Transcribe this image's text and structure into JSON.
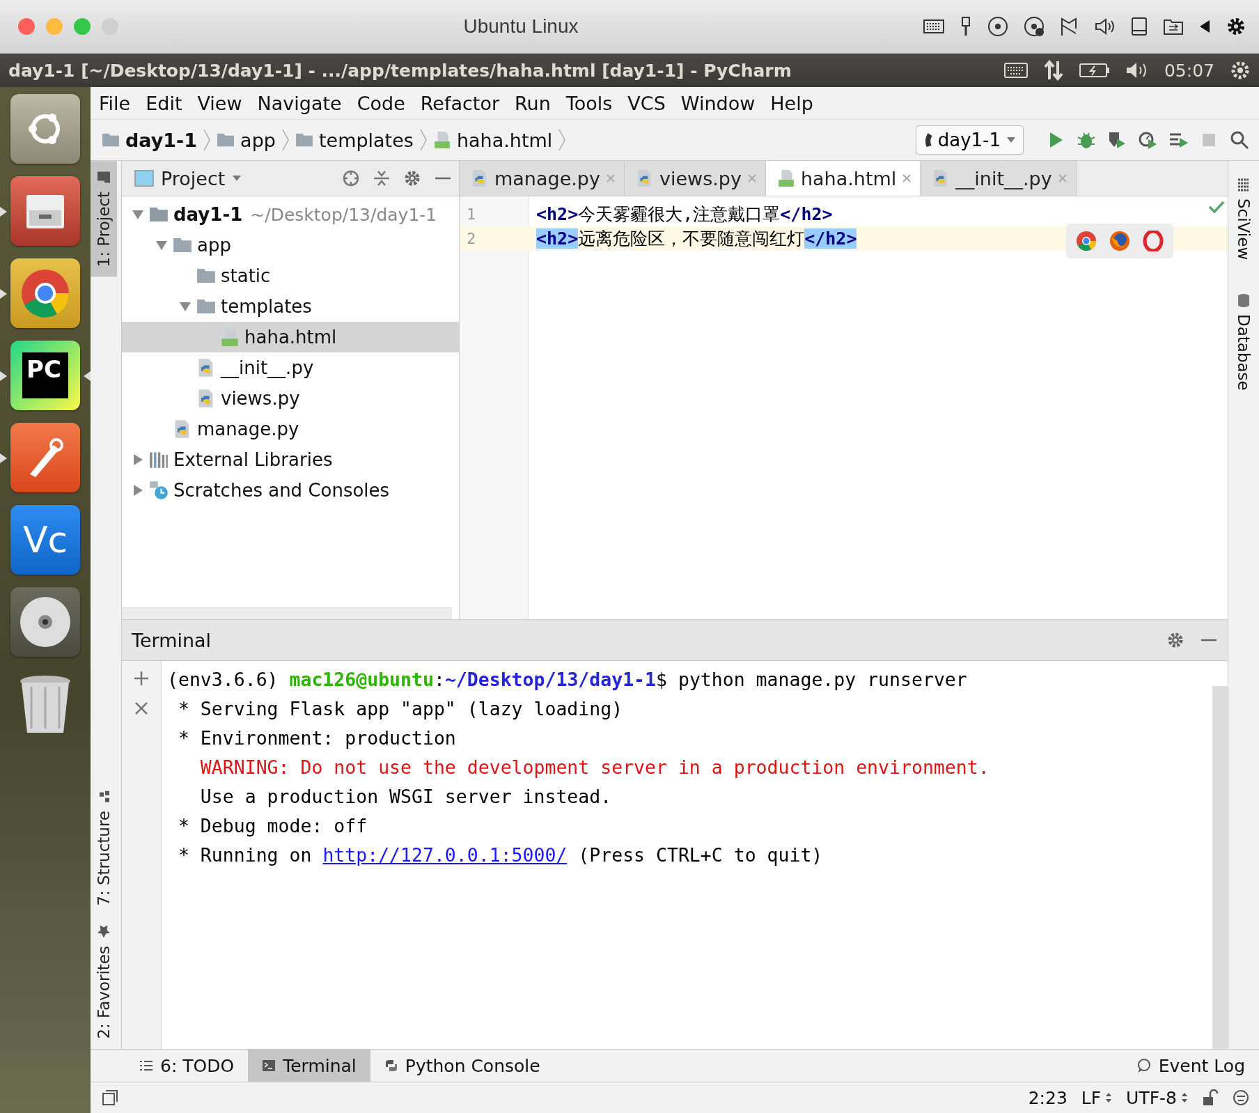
{
  "mac_window": {
    "title": "Ubuntu Linux"
  },
  "ubuntu_panel": {
    "title": "day1-1 [~/Desktop/13/day1-1] - .../app/templates/haha.html [day1-1] - PyCharm",
    "clock": "05:07"
  },
  "launcher": [
    {
      "kind": "ubuntu",
      "running": false,
      "focused": false
    },
    {
      "kind": "files",
      "running": true,
      "focused": false
    },
    {
      "kind": "chrome",
      "running": true,
      "focused": false
    },
    {
      "kind": "pycharm",
      "label": "PC",
      "running": true,
      "focused": true
    },
    {
      "kind": "postman",
      "running": true,
      "focused": false
    },
    {
      "kind": "vnc",
      "label": "Vc",
      "running": false,
      "focused": false
    },
    {
      "kind": "disc",
      "running": false,
      "focused": false
    },
    {
      "kind": "trash",
      "running": false,
      "focused": false
    }
  ],
  "menu": [
    "File",
    "Edit",
    "View",
    "Navigate",
    "Code",
    "Refactor",
    "Run",
    "Tools",
    "VCS",
    "Window",
    "Help"
  ],
  "breadcrumbs": [
    {
      "label": "day1-1",
      "kind": "project"
    },
    {
      "label": "app",
      "kind": "folder"
    },
    {
      "label": "templates",
      "kind": "folder"
    },
    {
      "label": "haha.html",
      "kind": "html"
    }
  ],
  "run_config": {
    "label": "day1-1"
  },
  "toolbar": [
    {
      "kind": "run",
      "disabled": false
    },
    {
      "kind": "debug",
      "disabled": false
    },
    {
      "kind": "coverage",
      "disabled": false
    },
    {
      "kind": "profile",
      "disabled": false
    },
    {
      "kind": "concurrency",
      "disabled": false
    },
    {
      "kind": "stop",
      "disabled": true
    },
    {
      "kind": "search",
      "disabled": false
    }
  ],
  "left_tool_tabs": {
    "top": [
      {
        "label": "1: Project",
        "selected": true,
        "kind": "project"
      }
    ],
    "bottom": [
      {
        "label": "7: Structure",
        "selected": false,
        "kind": "structure"
      },
      {
        "label": "2: Favorites",
        "selected": false,
        "kind": "favorites"
      }
    ]
  },
  "right_tool_tabs": [
    {
      "label": "SciView",
      "kind": "sciview"
    },
    {
      "label": "Database",
      "kind": "database"
    }
  ],
  "project_panel": {
    "title": "Project",
    "tree": [
      {
        "label": "day1-1",
        "path": "~/Desktop/13/day1-1",
        "kind": "project",
        "expanded": true,
        "selected": false,
        "children": [
          {
            "label": "app",
            "kind": "folder",
            "expanded": true,
            "selected": false,
            "children": [
              {
                "label": "static",
                "kind": "folder",
                "selected": false
              },
              {
                "label": "templates",
                "kind": "folder",
                "expanded": true,
                "selected": false,
                "children": [
                  {
                    "label": "haha.html",
                    "kind": "html",
                    "selected": true
                  }
                ]
              },
              {
                "label": "__init__.py",
                "kind": "python",
                "selected": false
              },
              {
                "label": "views.py",
                "kind": "python",
                "selected": false
              }
            ]
          },
          {
            "label": "manage.py",
            "kind": "python",
            "selected": false
          }
        ]
      },
      {
        "label": "External Libraries",
        "kind": "libraries",
        "expanded": false,
        "selected": false
      },
      {
        "label": "Scratches and Consoles",
        "kind": "scratches",
        "expanded": false,
        "selected": false
      }
    ]
  },
  "editor_tabs": [
    {
      "label": "manage.py",
      "kind": "python",
      "selected": false
    },
    {
      "label": "views.py",
      "kind": "python",
      "selected": false
    },
    {
      "label": "haha.html",
      "kind": "html",
      "selected": true
    },
    {
      "label": "__init__.py",
      "kind": "python",
      "selected": false
    }
  ],
  "editor": {
    "lines": [
      {
        "number": "1",
        "current": false,
        "segments": [
          {
            "text": "<h2>",
            "kind": "tag",
            "matched": false
          },
          {
            "text": "今天雾霾很大,注意戴口罩",
            "kind": "text"
          },
          {
            "text": "</h2>",
            "kind": "tag",
            "matched": false
          }
        ]
      },
      {
        "number": "2",
        "current": true,
        "segments": [
          {
            "text": "<h2>",
            "kind": "tag",
            "matched": true
          },
          {
            "text": "远离危险区，不要随意闯红灯",
            "kind": "text"
          },
          {
            "text": "</h2>",
            "kind": "tag",
            "matched": true
          }
        ]
      }
    ]
  },
  "terminal": {
    "title": "Terminal",
    "lines": [
      [
        {
          "text": "(env3.6.6) ",
          "kind": "plain"
        },
        {
          "text": "mac126@ubuntu",
          "kind": "user"
        },
        {
          "text": ":",
          "kind": "plain"
        },
        {
          "text": "~/Desktop/13/day1-1",
          "kind": "path"
        },
        {
          "text": "$ python manage.py runserver",
          "kind": "plain"
        }
      ],
      [
        {
          "text": " * Serving Flask app \"app\" (lazy loading)",
          "kind": "plain"
        }
      ],
      [
        {
          "text": " * Environment: production",
          "kind": "plain"
        }
      ],
      [
        {
          "text": "   WARNING: Do not use the development server in a production environment.",
          "kind": "warning"
        }
      ],
      [
        {
          "text": "   Use a production WSGI server instead.",
          "kind": "plain"
        }
      ],
      [
        {
          "text": " * Debug mode: off",
          "kind": "plain"
        }
      ],
      [
        {
          "text": " * Running on ",
          "kind": "plain"
        },
        {
          "text": "http://127.0.0.1:5000/",
          "kind": "link"
        },
        {
          "text": " (Press CTRL+C to quit)",
          "kind": "plain"
        }
      ]
    ]
  },
  "bottom_tabs": [
    {
      "label": "6: TODO",
      "kind": "todo",
      "selected": false
    },
    {
      "label": "Terminal",
      "kind": "terminal",
      "selected": true
    },
    {
      "label": "Python Console",
      "kind": "python",
      "selected": false
    }
  ],
  "event_log": {
    "label": "Event Log"
  },
  "status_bar": {
    "position": "2:23",
    "line_separator": "LF",
    "encoding": "UTF-8"
  }
}
